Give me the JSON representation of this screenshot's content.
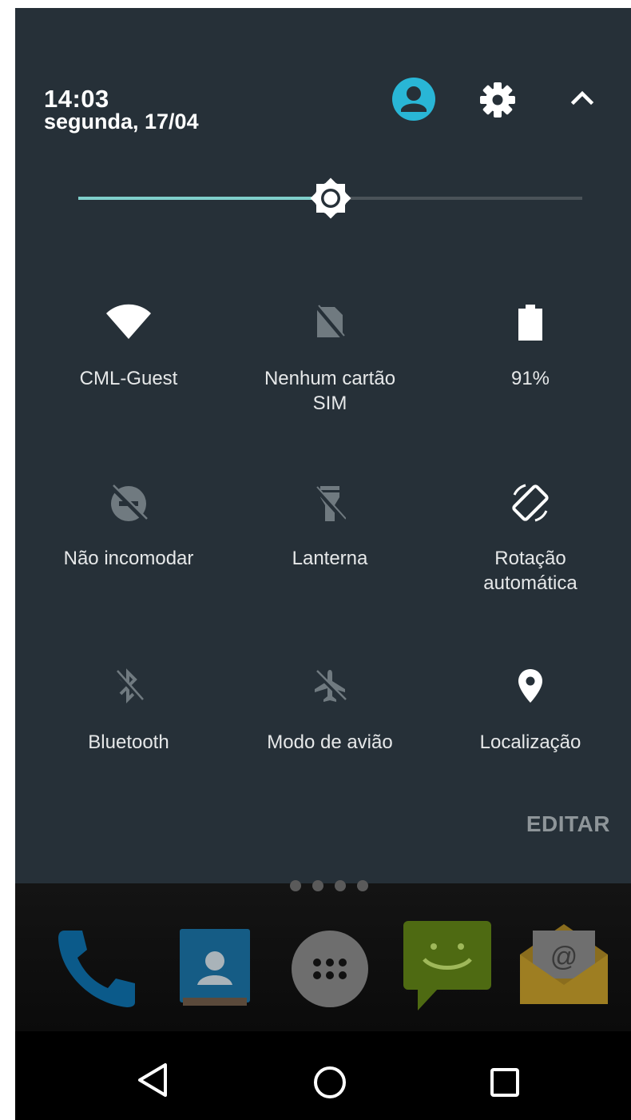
{
  "status": {
    "time": "14:03",
    "date": "segunda, 17/04"
  },
  "header_icons": [
    "account-icon",
    "settings-icon",
    "collapse-icon"
  ],
  "brightness": {
    "level": 0.5
  },
  "tiles": [
    {
      "label": "CML-Guest",
      "icon": "wifi-icon",
      "active": true
    },
    {
      "label": "Nenhum cartão\nSIM",
      "icon": "no-sim-icon",
      "active": false
    },
    {
      "label": "91%",
      "icon": "battery-icon",
      "active": true
    },
    {
      "label": "Não incomodar",
      "icon": "do-not-disturb-off-icon",
      "active": false
    },
    {
      "label": "Lanterna",
      "icon": "flashlight-off-icon",
      "active": false
    },
    {
      "label": "Rotação\nautomática",
      "icon": "rotation-icon",
      "active": true
    },
    {
      "label": "Bluetooth",
      "icon": "bluetooth-off-icon",
      "active": false
    },
    {
      "label": "Modo de avião",
      "icon": "airplane-off-icon",
      "active": false
    },
    {
      "label": "Localização",
      "icon": "location-icon",
      "active": true
    }
  ],
  "edit_label": "EDITAR",
  "dock_apps": [
    "phone-icon",
    "contacts-icon",
    "app-drawer-icon",
    "messaging-icon",
    "email-icon"
  ],
  "nav": [
    "back-icon",
    "home-icon",
    "recents-icon"
  ],
  "colors": {
    "accent": "#29b6d6",
    "shade": "#263038",
    "slider": "#7fcfcb"
  }
}
